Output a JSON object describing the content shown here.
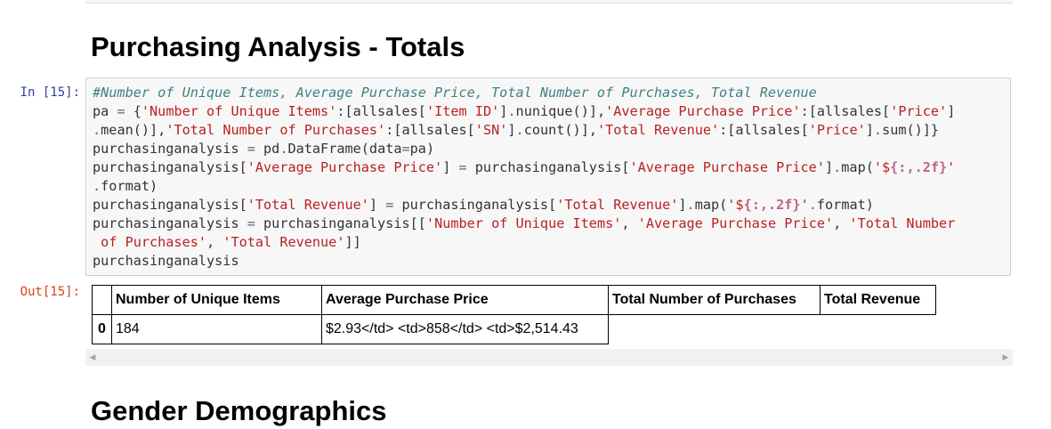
{
  "section_title": "Purchasing Analysis - Totals",
  "next_section_title": "Gender Demographics",
  "input_prompt": "In [15]:",
  "output_prompt": "Out[15]:",
  "code_lines": [
    [
      [
        "c",
        "#Number of Unique Items, Average Purchase Price, Total Number of Purchases, Total Revenue"
      ]
    ],
    [
      [
        "",
        "pa "
      ],
      [
        "o",
        "="
      ],
      [
        "",
        " {"
      ],
      [
        "s",
        "'Number of Unique Items'"
      ],
      [
        "",
        ":[allsales["
      ],
      [
        "s",
        "'Item ID'"
      ],
      [
        "",
        "]"
      ],
      [
        "o",
        "."
      ],
      [
        "",
        "nunique()],"
      ],
      [
        "s",
        "'Average Purchase Price'"
      ],
      [
        "",
        ":[allsales["
      ],
      [
        "s",
        "'Price'"
      ],
      [
        "",
        "]"
      ]
    ],
    [
      [
        "o",
        "."
      ],
      [
        "",
        "mean()],"
      ],
      [
        "s",
        "'Total Number of Purchases'"
      ],
      [
        "",
        ":[allsales["
      ],
      [
        "s",
        "'SN'"
      ],
      [
        "",
        "]"
      ],
      [
        "o",
        "."
      ],
      [
        "",
        "count()],"
      ],
      [
        "s",
        "'Total Revenue'"
      ],
      [
        "",
        ":[allsales["
      ],
      [
        "s",
        "'Price'"
      ],
      [
        "",
        "]"
      ],
      [
        "o",
        "."
      ],
      [
        "",
        "sum()]}"
      ]
    ],
    [
      [
        "",
        "purchasinganalysis "
      ],
      [
        "o",
        "="
      ],
      [
        "",
        " pd"
      ],
      [
        "o",
        "."
      ],
      [
        "",
        "DataFrame(data"
      ],
      [
        "o",
        "="
      ],
      [
        "",
        "pa)"
      ]
    ],
    [
      [
        "",
        "purchasinganalysis["
      ],
      [
        "s",
        "'Average Purchase Price'"
      ],
      [
        "",
        "] "
      ],
      [
        "o",
        "="
      ],
      [
        "",
        " purchasinganalysis["
      ],
      [
        "s",
        "'Average Purchase Price'"
      ],
      [
        "",
        "]"
      ],
      [
        "o",
        "."
      ],
      [
        "",
        "map("
      ],
      [
        "s",
        "'$"
      ],
      [
        "si",
        "{:,.2f}"
      ],
      [
        "s",
        "'"
      ]
    ],
    [
      [
        "o",
        "."
      ],
      [
        "",
        "format)"
      ]
    ],
    [
      [
        "",
        "purchasinganalysis["
      ],
      [
        "s",
        "'Total Revenue'"
      ],
      [
        "",
        "] "
      ],
      [
        "o",
        "="
      ],
      [
        "",
        " purchasinganalysis["
      ],
      [
        "s",
        "'Total Revenue'"
      ],
      [
        "",
        "]"
      ],
      [
        "o",
        "."
      ],
      [
        "",
        "map("
      ],
      [
        "s",
        "'$"
      ],
      [
        "si",
        "{:,.2f}"
      ],
      [
        "s",
        "'"
      ],
      [
        "o",
        "."
      ],
      [
        "",
        "format)"
      ]
    ],
    [
      [
        "",
        "purchasinganalysis "
      ],
      [
        "o",
        "="
      ],
      [
        "",
        " purchasinganalysis[["
      ],
      [
        "s",
        "'Number of Unique Items'"
      ],
      [
        "",
        ", "
      ],
      [
        "s",
        "'Average Purchase Price'"
      ],
      [
        "",
        ", "
      ],
      [
        "s",
        "'Total Number"
      ]
    ],
    [
      [
        "s",
        " of Purchases'"
      ],
      [
        "",
        ", "
      ],
      [
        "s",
        "'Total Revenue'"
      ],
      [
        "",
        "]]"
      ]
    ],
    [
      [
        "",
        "purchasinganalysis"
      ]
    ]
  ],
  "output_table": {
    "headers": [
      "",
      "Number of Unique Items",
      "Average Purchase Price",
      "Total Number of Purchases",
      "Total Revenue"
    ],
    "row": {
      "index": "0",
      "unique_items": "184",
      "avg_price": "$2.93</td> <td>858</td> <td>$2,514.43"
    }
  },
  "scrollbar": {
    "left_arrow": "◀",
    "right_arrow": "▶"
  }
}
